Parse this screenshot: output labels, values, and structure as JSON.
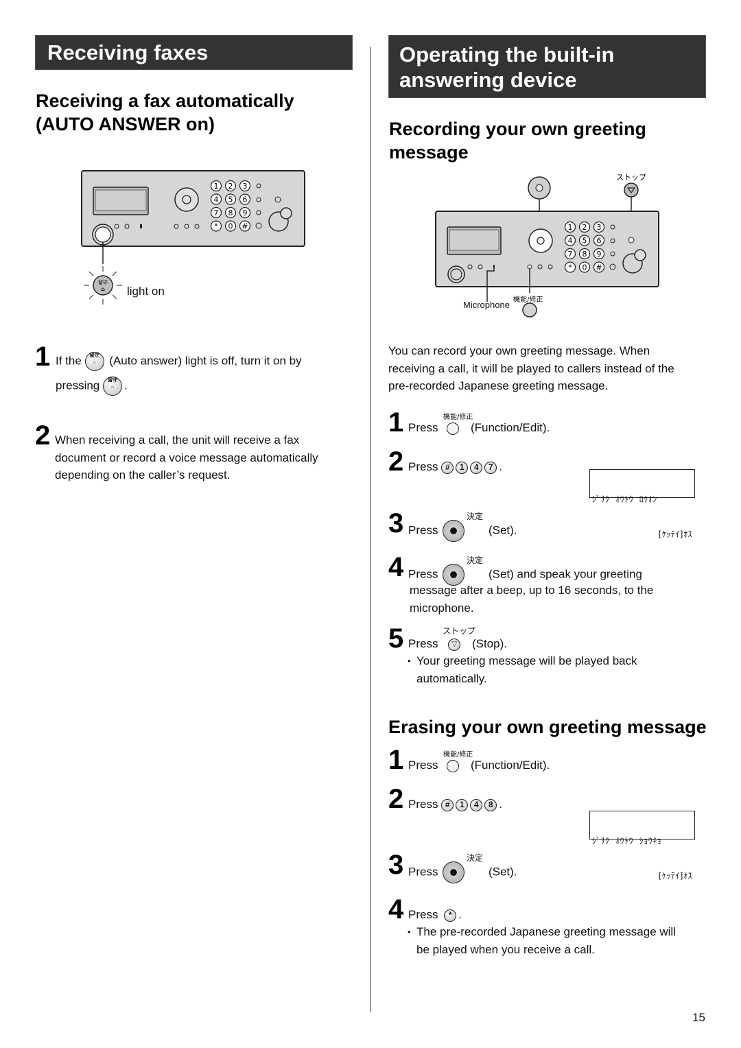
{
  "left": {
    "banner_title": "Receiving faxes",
    "section_title_line1": "Receiving a fax automatically",
    "section_title_line2": "(AUTO ANSWER on)",
    "diagram": {
      "light_label": "light on",
      "auto_answer_button_label_jp": "留守",
      "keypad_keys": [
        "1",
        "2",
        "3",
        "4",
        "5",
        "6",
        "7",
        "8",
        "9",
        "*",
        "0",
        "#"
      ]
    },
    "steps": [
      {
        "number": "1",
        "text_before": "If the",
        "text_after": "(Auto answer) light is off, turn it on by",
        "line2_before": "pressing",
        "line2_after": "."
      },
      {
        "number": "2",
        "lines": [
          "When receiving a call, the unit will receive a fax",
          "document or record a voice message automatically",
          "depending on the caller’s request."
        ]
      }
    ]
  },
  "right": {
    "banner_title_line1": "Operating the built-in",
    "banner_title_line2": "answering device",
    "recording": {
      "title_line1": "Recording your own greeting",
      "title_line2": "message",
      "diagram": {
        "stop_label_jp": "ストップ",
        "microphone_label": "Microphone",
        "function_label_jp": "機能/修正"
      },
      "intro_lines": [
        "You can record your own greeting message. When",
        "receiving a call, it will be played to callers instead of the",
        "pre-recorded Japanese greeting message."
      ],
      "steps": [
        {
          "number": "1",
          "press": "Press",
          "key_label_jp": "機能/修正",
          "suffix": "(Function/Edit)."
        },
        {
          "number": "2",
          "press": "Press",
          "keys": [
            "#",
            "1",
            "4",
            "7"
          ],
          "suffix": "."
        },
        {
          "number": "3",
          "press": "Press",
          "key_label_jp": "決定",
          "suffix": "(Set)."
        },
        {
          "number": "4",
          "press": "Press",
          "key_label_jp": "決定",
          "suffix": "(Set) and speak your greeting",
          "cont_lines": [
            "message after a beep, up to 16 seconds, to the",
            "microphone."
          ]
        },
        {
          "number": "5",
          "press": "Press",
          "key_label_jp": "ストップ",
          "suffix": "(Stop).",
          "bullet_lines": [
            "Your greeting message will be played back",
            "automatically."
          ]
        }
      ],
      "lcd_line1": "ｼﾞｻｸ  ｵｳﾄｳ  ﾛｸｵﾝ",
      "lcd_line2": "[ｹｯﾃｲ]ｵｽ"
    },
    "erasing": {
      "title": "Erasing your own greeting message",
      "steps": [
        {
          "number": "1",
          "press": "Press",
          "key_label_jp": "機能/修正",
          "suffix": "(Function/Edit)."
        },
        {
          "number": "2",
          "press": "Press",
          "keys": [
            "#",
            "1",
            "4",
            "8"
          ],
          "suffix": "."
        },
        {
          "number": "3",
          "press": "Press",
          "key_label_jp": "決定",
          "suffix": "(Set)."
        },
        {
          "number": "4",
          "press": "Press",
          "keys": [
            "*"
          ],
          "suffix": ".",
          "bullet_lines": [
            "The pre-recorded Japanese greeting message will",
            "be played when you receive a call."
          ]
        }
      ],
      "lcd_line1": "ｼﾞｻｸ  ｵｳﾄｳ  ｼｮｳｷｮ",
      "lcd_line2": "[ｹｯﾃｲ]ｵｽ"
    }
  },
  "page_number": "15"
}
